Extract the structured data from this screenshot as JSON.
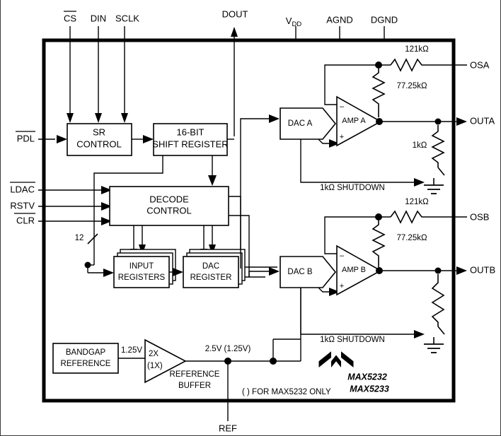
{
  "title": "MAX5232/MAX5233 Functional Block Diagram",
  "part_numbers": [
    "MAX5232",
    "MAX5233"
  ],
  "brand": "MAXIM",
  "footnote": "( ) FOR MAX5232 ONLY",
  "pins": {
    "top": [
      {
        "name": "CS",
        "label": "CS",
        "overbar": true
      },
      {
        "name": "DIN",
        "label": "DIN",
        "overbar": false
      },
      {
        "name": "SCLK",
        "label": "SCLK",
        "overbar": false
      },
      {
        "name": "DOUT",
        "label": "DOUT",
        "overbar": false
      },
      {
        "name": "VDD",
        "label": "V",
        "sub": "DD",
        "overbar": false
      },
      {
        "name": "AGND",
        "label": "AGND",
        "overbar": false
      },
      {
        "name": "DGND",
        "label": "DGND",
        "overbar": false
      }
    ],
    "left": [
      {
        "name": "PDL",
        "label": "PDL",
        "overbar": true
      },
      {
        "name": "LDAC",
        "label": "LDAC",
        "overbar": true
      },
      {
        "name": "RSTV",
        "label": "RSTV",
        "overbar": false
      },
      {
        "name": "CLR",
        "label": "CLR",
        "overbar": true
      }
    ],
    "right": [
      {
        "name": "OSA",
        "label": "OSA"
      },
      {
        "name": "OUTA",
        "label": "OUTA"
      },
      {
        "name": "OSB",
        "label": "OSB"
      },
      {
        "name": "OUTB",
        "label": "OUTB"
      }
    ],
    "bottom": [
      {
        "name": "REF",
        "label": "REF"
      }
    ]
  },
  "blocks": {
    "sr_control": {
      "line1": "SR",
      "line2": "CONTROL"
    },
    "shift_register": {
      "line1": "16-BIT",
      "line2": "SHIFT REGISTER"
    },
    "decode_control": {
      "line1": "DECODE",
      "line2": "CONTROL"
    },
    "input_registers": {
      "line1": "INPUT",
      "line2": "REGISTERS"
    },
    "dac_register": {
      "line1": "DAC",
      "line2": "REGISTER"
    },
    "bandgap": {
      "line1": "BANDGAP",
      "line2": "REFERENCE"
    },
    "ref_buffer": {
      "gain1": "2X",
      "gain2": "(1X)",
      "line1": "REFERENCE",
      "line2": "BUFFER"
    },
    "dac_a": {
      "label": "DAC A"
    },
    "dac_b": {
      "label": "DAC B"
    },
    "amp_a": {
      "label": "AMP A"
    },
    "amp_b": {
      "label": "AMP B"
    }
  },
  "annotations": {
    "bus_width": "12",
    "bandgap_out": "1.25V",
    "ref_out": "2.5V (1.25V)",
    "shutdown_a": "1kΩ SHUTDOWN",
    "shutdown_b": "1kΩ SHUTDOWN",
    "amp_minus": "–",
    "amp_plus": "+"
  },
  "resistors": {
    "feedback_a": "121kΩ",
    "divider_a": "77.25kΩ",
    "load_a": "1kΩ",
    "feedback_b": "121kΩ",
    "divider_b": "77.25kΩ",
    "load_b": ""
  },
  "colors": {
    "line": "#000000",
    "border": "#000000",
    "text": "#000000",
    "background": "#ffffff"
  }
}
